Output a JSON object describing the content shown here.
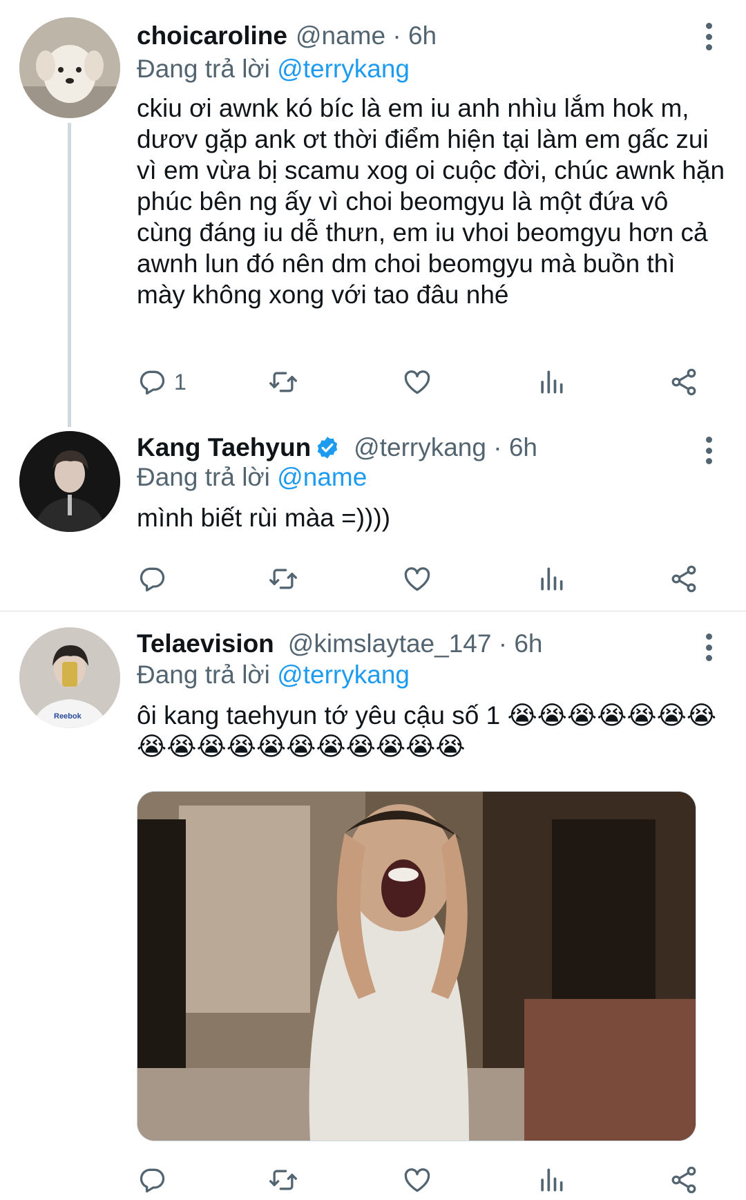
{
  "tweets": [
    {
      "display_name": "choicaroline",
      "handle_time": "@name · 6h",
      "reply_prefix": "Đang trả lời",
      "reply_mention": "@terrykang",
      "text": "ckiu ơi awnk kó bíc là em iu anh nhìu lắm hok m, dươv gặp ank ơt thời điểm hiện tại làm em gấc zui vì em vừa bị scamu xog oi cuộc đời, chúc awnk hặn phúc bên ng ấy vì choi beomgyu là một đứa vô cùng đáng iu dễ thưn, em iu vhoi beomgyu hơn cả awnh lun đó nên dm choi beomgyu mà buồn thì mày không xong với tao đâu nhé",
      "reply_count": "1"
    },
    {
      "display_name": "Kang Taehyun",
      "verified": true,
      "handle_time": "@terrykang · 6h",
      "reply_prefix": "Đang trả lời",
      "reply_mention": "@name",
      "text": "mình biết rùi màa =))))",
      "reply_count": ""
    },
    {
      "display_name": "Telaevision",
      "handle_time": "@kimslaytae_147 · 6h",
      "reply_prefix": "Đang trả lời",
      "reply_mention": "@terrykang",
      "text": "ôi kang taehyun tớ yêu cậu số 1 😭😭😭😭😭😭😭😭😭😭😭😭😭😭😭😭😭😭",
      "reply_count": ""
    }
  ],
  "colors": {
    "accent": "#1d9bf0",
    "secondary_text": "#536471",
    "primary_text": "#0f1419"
  },
  "icons": [
    "reply-icon",
    "retweet-icon",
    "like-icon",
    "analytics-icon",
    "share-icon",
    "more-icon",
    "verified-badge-icon"
  ]
}
